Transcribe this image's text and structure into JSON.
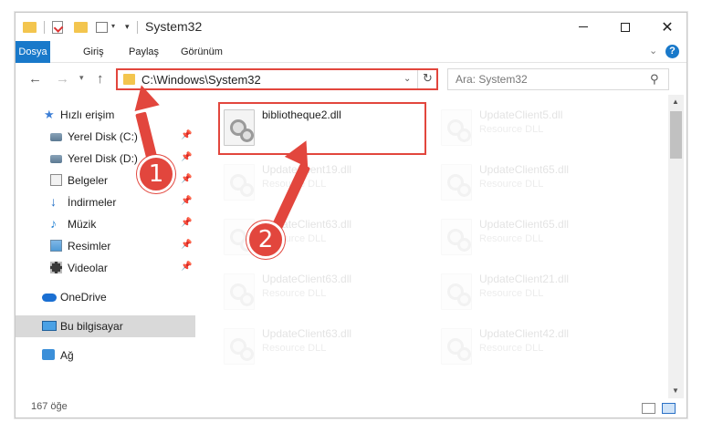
{
  "window": {
    "title": "System32",
    "controls": {
      "minimize": "minimize-icon",
      "maximize": "maximize-icon",
      "close": "close-icon"
    }
  },
  "ribbon": {
    "tabs": [
      "Dosya",
      "Giriş",
      "Paylaş",
      "Görünüm"
    ],
    "help": "?"
  },
  "nav": {
    "address": "C:\\Windows\\System32",
    "search_placeholder": "Ara: System32"
  },
  "sidebar": {
    "items": [
      {
        "label": "Hızlı erişim",
        "icon": "star-icon"
      },
      {
        "label": "Yerel Disk (C:)",
        "icon": "drive-icon",
        "pinned": true
      },
      {
        "label": "Yerel Disk (D:)",
        "icon": "drive-icon",
        "pinned": true
      },
      {
        "label": "Belgeler",
        "icon": "documents-icon",
        "pinned": true
      },
      {
        "label": "İndirmeler",
        "icon": "download-icon",
        "pinned": true
      },
      {
        "label": "Müzik",
        "icon": "music-icon",
        "pinned": true
      },
      {
        "label": "Resimler",
        "icon": "pictures-icon",
        "pinned": true
      },
      {
        "label": "Videolar",
        "icon": "videos-icon",
        "pinned": true
      },
      {
        "label": "OneDrive",
        "icon": "cloud-icon"
      },
      {
        "label": "Bu bilgisayar",
        "icon": "computer-icon",
        "selected": true
      },
      {
        "label": "Ağ",
        "icon": "network-icon"
      }
    ]
  },
  "files": [
    {
      "name": "bibliotheque2.dll",
      "type": ""
    },
    {
      "name": "UpdateClient5.dll",
      "type": "Resource DLL"
    },
    {
      "name": "UpdateClient19.dll",
      "type": "Resource DLL"
    },
    {
      "name": "UpdateClient65.dll",
      "type": "Resource DLL"
    },
    {
      "name": "UpdateClient63.dll",
      "type": "Resource DLL"
    },
    {
      "name": "UpdateClient65.dll",
      "type": "Resource DLL"
    },
    {
      "name": "UpdateClient63.dll",
      "type": "Resource DLL"
    },
    {
      "name": "UpdateClient21.dll",
      "type": "Resource DLL"
    },
    {
      "name": "UpdateClient63.dll",
      "type": "Resource DLL"
    },
    {
      "name": "UpdateClient42.dll",
      "type": "Resource DLL"
    }
  ],
  "status": {
    "count": "167 öğe"
  },
  "annotations": {
    "badge1": "1",
    "badge2": "2",
    "color": "#e2463d"
  }
}
